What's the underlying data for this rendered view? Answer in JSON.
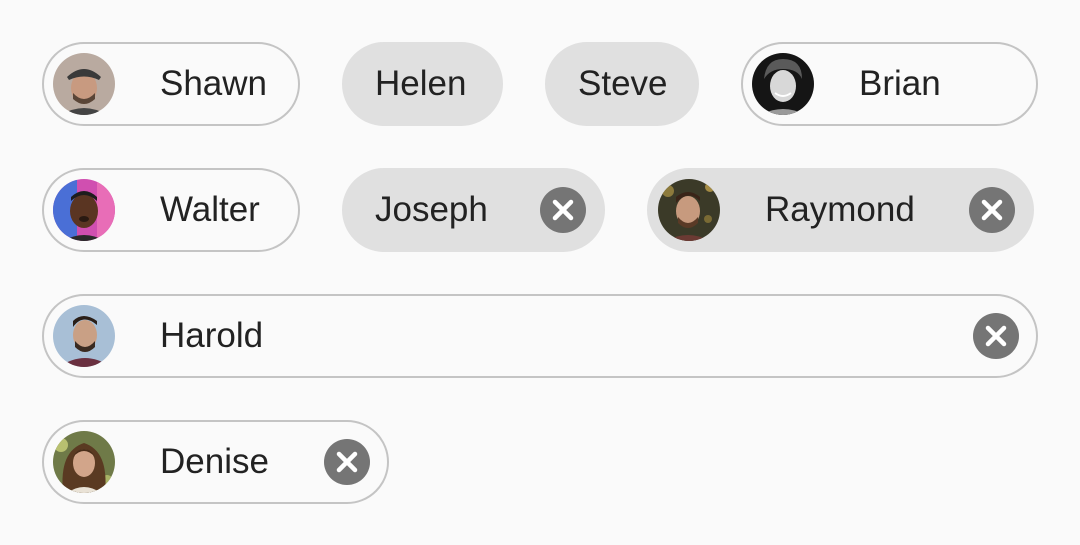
{
  "chips": {
    "shawn": {
      "label": "Shawn",
      "avatar": "avatar-photo"
    },
    "helen": {
      "label": "Helen"
    },
    "steve": {
      "label": "Steve"
    },
    "brian": {
      "label": "Brian",
      "avatar": "avatar-photo"
    },
    "walter": {
      "label": "Walter",
      "avatar": "avatar-photo"
    },
    "joseph": {
      "label": "Joseph",
      "delete_icon": "close-icon"
    },
    "raymond": {
      "label": "Raymond",
      "avatar": "avatar-photo",
      "delete_icon": "close-icon"
    },
    "harold": {
      "label": "Harold",
      "avatar": "avatar-photo",
      "delete_icon": "close-icon"
    },
    "denise": {
      "label": "Denise",
      "avatar": "avatar-photo",
      "delete_icon": "close-icon"
    }
  },
  "colors": {
    "background": "#fafafa",
    "chip_filled": "#e0e0e0",
    "chip_border": "#c4c4c4",
    "text": "#222222",
    "delete_icon_bg": "#757575"
  }
}
